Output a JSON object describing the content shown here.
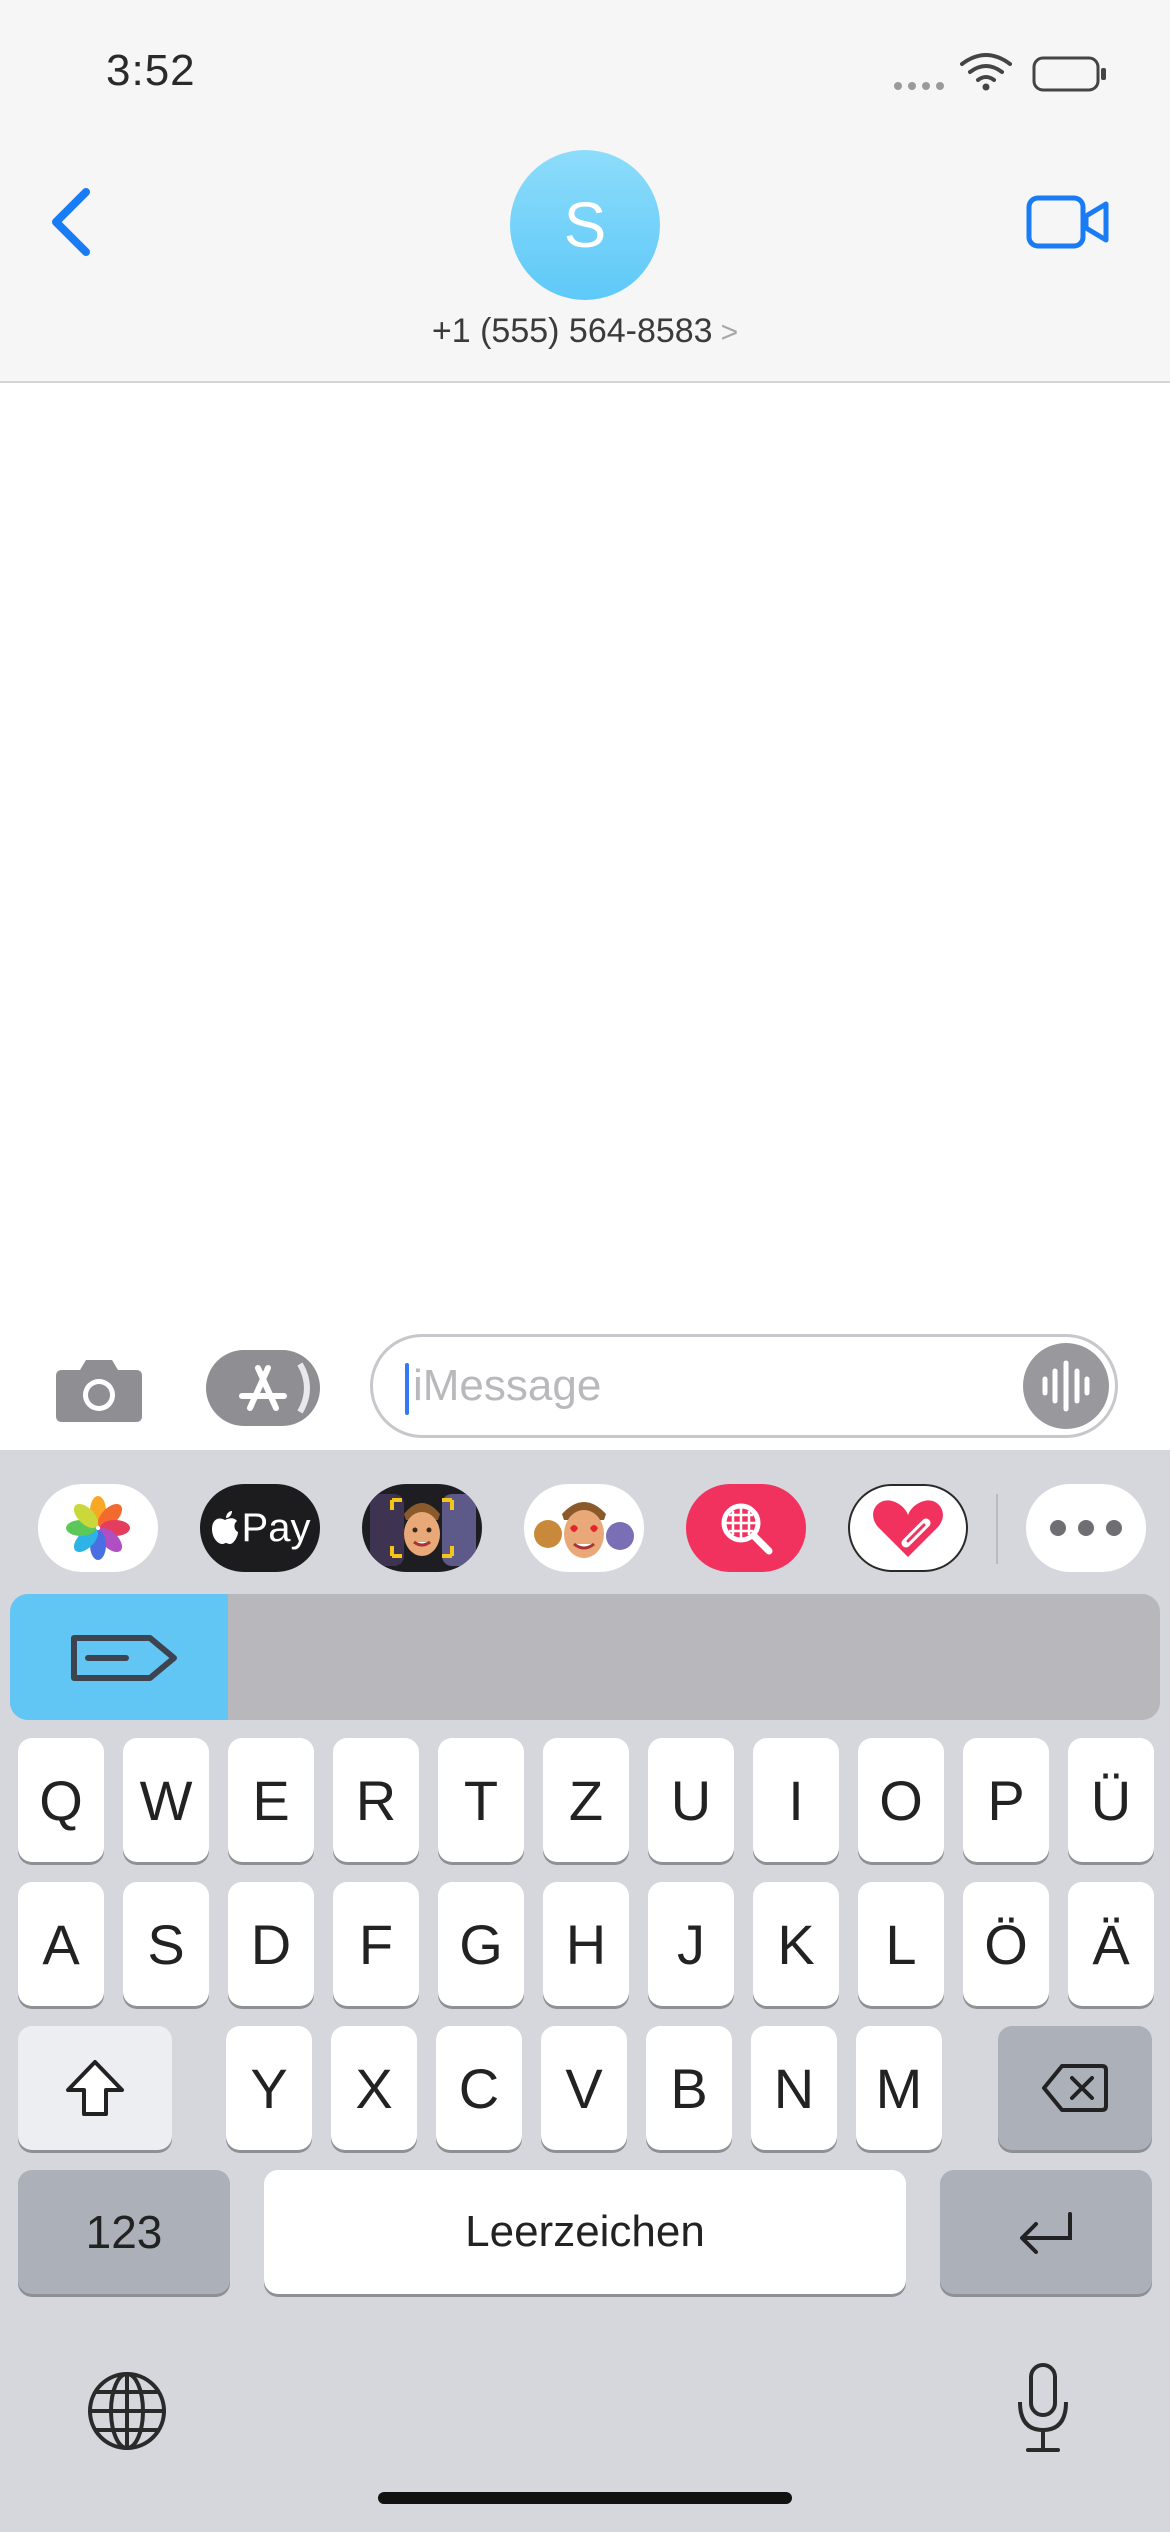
{
  "status_bar": {
    "time": "3:52"
  },
  "header": {
    "avatar_initial": "S",
    "contact": "+1 (555) 564-8583",
    "contact_chevron": ">"
  },
  "compose": {
    "placeholder": "iMessage"
  },
  "app_strip": {
    "items": [
      "photos-icon",
      "apple-pay-icon",
      "memoji-stickers-icon",
      "memoji-icon",
      "image-search-icon",
      "digital-touch-icon",
      "more-apps-icon"
    ],
    "apple_pay_label": "Pay"
  },
  "keyboard": {
    "row1": [
      "Q",
      "W",
      "E",
      "R",
      "T",
      "Z",
      "U",
      "I",
      "O",
      "P",
      "Ü"
    ],
    "row2": [
      "A",
      "S",
      "D",
      "F",
      "G",
      "H",
      "J",
      "K",
      "L",
      "Ö",
      "Ä"
    ],
    "row3": [
      "Y",
      "X",
      "C",
      "V",
      "B",
      "N",
      "M"
    ],
    "numbers_label": "123",
    "space_label": "Leerzeichen"
  },
  "colors": {
    "accent": "#1a7cf5",
    "avatar": "#6ecdf8",
    "keyboard_bg": "#d5d7dd"
  }
}
